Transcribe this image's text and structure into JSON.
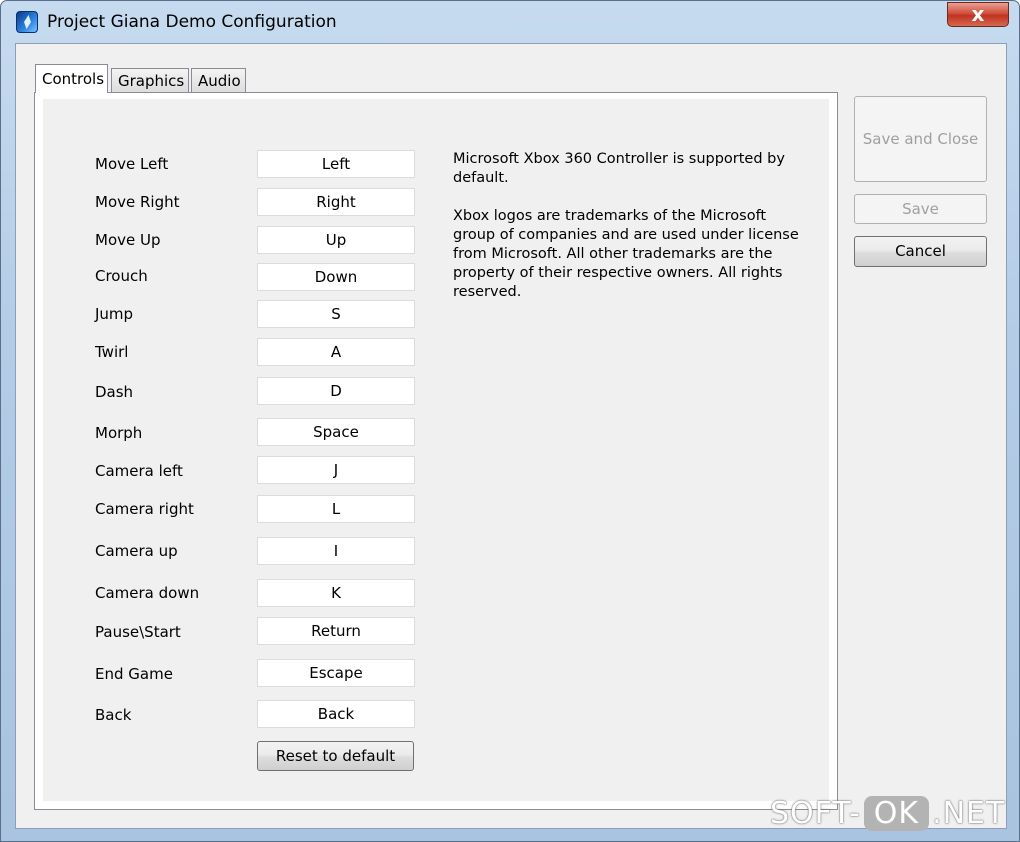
{
  "window": {
    "title": "Project Giana Demo Configuration",
    "close_glyph": "x"
  },
  "tabs": [
    {
      "label": "Controls",
      "active": true
    },
    {
      "label": "Graphics",
      "active": false
    },
    {
      "label": "Audio",
      "active": false
    }
  ],
  "controls": [
    {
      "action": "Move Left",
      "key": "Left"
    },
    {
      "action": "Move Right",
      "key": "Right"
    },
    {
      "action": "Move Up",
      "key": "Up"
    },
    {
      "action": "Crouch",
      "key": "Down"
    },
    {
      "action": "Jump",
      "key": "S"
    },
    {
      "action": "Twirl",
      "key": "A"
    },
    {
      "action": "Dash",
      "key": "D"
    },
    {
      "action": "Morph",
      "key": "Space"
    },
    {
      "action": "Camera left",
      "key": "J"
    },
    {
      "action": "Camera right",
      "key": "L"
    },
    {
      "action": "Camera up",
      "key": "I"
    },
    {
      "action": "Camera down",
      "key": "K"
    },
    {
      "action": "Pause\\Start",
      "key": "Return"
    },
    {
      "action": "End Game",
      "key": "Escape"
    },
    {
      "action": "Back",
      "key": "Back"
    }
  ],
  "reset_label": "Reset to default",
  "info": {
    "line1": "Microsoft Xbox 360 Controller is supported by default.",
    "line2": "Xbox logos are trademarks of the Microsoft group of companies and are used under license from Microsoft. All other trademarks are the property of their respective owners. All rights reserved."
  },
  "buttons": {
    "save_and_close": "Save and Close",
    "save": "Save",
    "cancel": "Cancel"
  },
  "watermark": {
    "pre": "SOFT-",
    "mid": "OK",
    "post": ".NET"
  },
  "colors": {
    "frame": "#b4cce6",
    "close_button": "#c9412f",
    "face": "#f0f0f0"
  }
}
